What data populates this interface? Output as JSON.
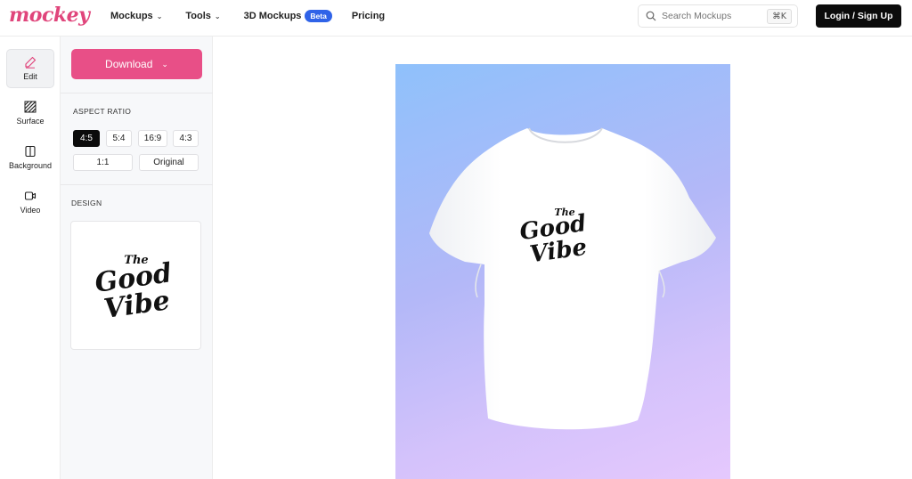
{
  "header": {
    "logo": "mockey",
    "nav": [
      {
        "label": "Mockups",
        "has_dropdown": true
      },
      {
        "label": "Tools",
        "has_dropdown": true
      },
      {
        "label": "3D Mockups",
        "badge": "Beta"
      },
      {
        "label": "Pricing"
      }
    ],
    "search_placeholder": "Search Mockups",
    "search_shortcut": "⌘K",
    "login_label": "Login / Sign Up"
  },
  "rail": [
    {
      "label": "Edit",
      "icon": "pencil-icon",
      "active": true
    },
    {
      "label": "Surface",
      "icon": "hatch-icon"
    },
    {
      "label": "Background",
      "icon": "background-icon"
    },
    {
      "label": "Video",
      "icon": "video-icon"
    }
  ],
  "panel": {
    "download_label": "Download",
    "aspect_ratio_title": "ASPECT RATIO",
    "aspect_ratios": [
      "4:5",
      "5:4",
      "16:9",
      "4:3",
      "1:1",
      "Original"
    ],
    "selected_ratio": "4:5",
    "design_title": "DESIGN"
  },
  "design": {
    "line1": "The",
    "line2": "Good",
    "line3": "Vibe"
  },
  "colors": {
    "brand": "#e0457b",
    "download": "#e84f87",
    "beta_badge": "#2f63e8",
    "login": "#0b0b0b"
  }
}
